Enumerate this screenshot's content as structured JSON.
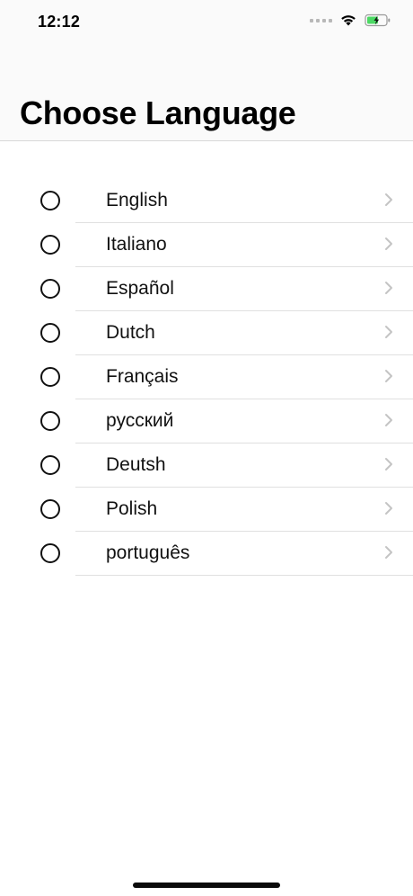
{
  "status_bar": {
    "time": "12:12",
    "icons": [
      "signal-dots-icon",
      "wifi-icon",
      "battery-charging-icon"
    ]
  },
  "header": {
    "title": "Choose Language"
  },
  "languages": [
    {
      "label": "English",
      "selected": false
    },
    {
      "label": "Italiano",
      "selected": false
    },
    {
      "label": "Español",
      "selected": false
    },
    {
      "label": "Dutch",
      "selected": false
    },
    {
      "label": "Français",
      "selected": false
    },
    {
      "label": "русский",
      "selected": false
    },
    {
      "label": "Deutsh",
      "selected": false
    },
    {
      "label": "Polish",
      "selected": false
    },
    {
      "label": "português",
      "selected": false
    }
  ],
  "colors": {
    "battery_green": "#4cd964",
    "separator": "#e0e0e0",
    "chevron": "#c4c4c4"
  }
}
